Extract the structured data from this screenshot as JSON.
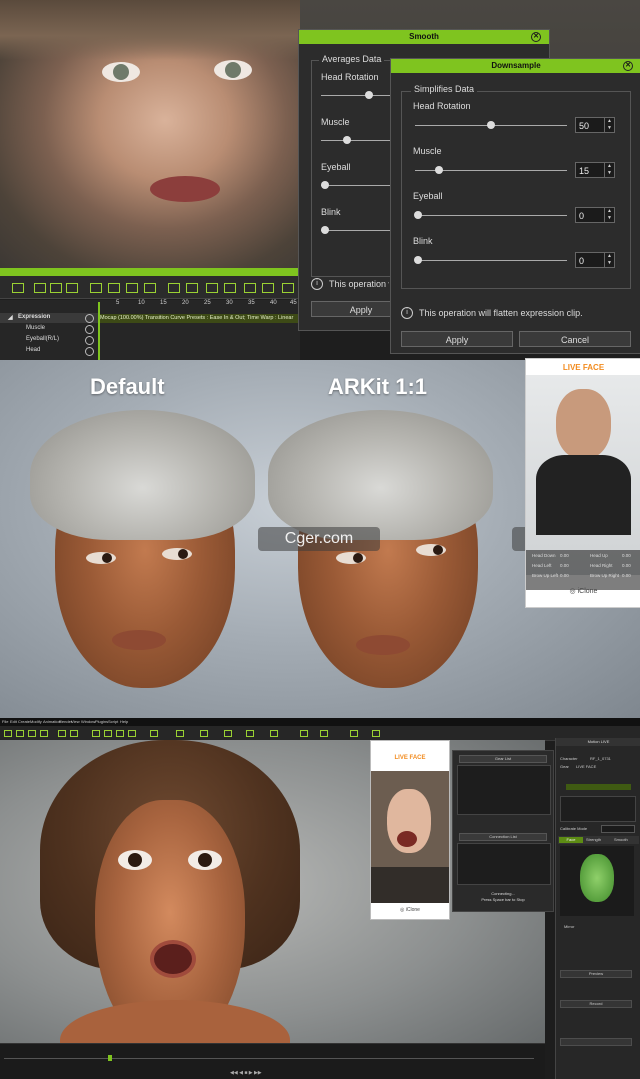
{
  "panel1": {
    "timeline": {
      "track_header": "Expression",
      "tracks": [
        "Muscle",
        "Eyeball(R/L)",
        "Head"
      ],
      "ticks": [
        "5",
        "10",
        "15",
        "20",
        "25",
        "30",
        "35",
        "40",
        "45"
      ],
      "clip_label": "Mocap (100.00%) Transition Curve Presets : Ease In & Out; Time Warp : Linear"
    },
    "smooth_dialog": {
      "title": "Smooth",
      "group_label": "Averages Data",
      "params": [
        {
          "label": "Head Rotation",
          "fraction": 0.72
        },
        {
          "label": "Muscle",
          "fraction": 0.38
        },
        {
          "label": "Eyeball",
          "fraction": 0.0
        },
        {
          "label": "Blink",
          "fraction": 0.0
        }
      ],
      "note": "This operation will flatten expression clip.",
      "apply_label": "Apply"
    },
    "downsample_dialog": {
      "title": "Downsample",
      "group_label": "Simplifies Data",
      "params": [
        {
          "label": "Head Rotation",
          "value": "50",
          "fraction": 0.5
        },
        {
          "label": "Muscle",
          "value": "15",
          "fraction": 0.15
        },
        {
          "label": "Eyeball",
          "value": "0",
          "fraction": 0.0
        },
        {
          "label": "Blink",
          "value": "0",
          "fraction": 0.0
        }
      ],
      "note": "This operation will flatten expression clip.",
      "apply_label": "Apply",
      "cancel_label": "Cancel"
    }
  },
  "panel2": {
    "left_title": "Default",
    "right_title": "ARKit 1:1",
    "watermark": "Cger.com",
    "phone": {
      "app_title": "LIVE FACE",
      "rows": [
        [
          "Head Down",
          "0.00",
          "Head Up",
          "0.00"
        ],
        [
          "Head Left",
          "0.00",
          "Head Right",
          "0.00"
        ],
        [
          "Brow Up Left",
          "0.00",
          "Brow Up Right",
          "0.00"
        ]
      ],
      "footer": "iClone"
    }
  },
  "panel3": {
    "menu": [
      "File",
      "Edit",
      "Create",
      "Modify",
      "Animation",
      "Render",
      "View",
      "Window",
      "Plugins",
      "Script",
      "Help"
    ],
    "phone": {
      "app_title": "LIVE FACE",
      "footer": "iClone"
    },
    "mid_panel": {
      "header": "Gear List",
      "sub_header": "Connection List",
      "status": "Connecting...",
      "status_sub": "Press Space bar to Stop"
    },
    "right_panel": {
      "title": "Motion LIVE",
      "character_label": "Character",
      "character_value": "RF_1_0731",
      "gear_label": "Gear",
      "gear_value": "LIVE FACE",
      "calibrate_label": "Calibrate Mode",
      "tabs": [
        "Face",
        "Strength",
        "Smooth"
      ],
      "mirror_label": "Mirror",
      "btn_preview": "Preview",
      "btn_record": "Record"
    }
  }
}
